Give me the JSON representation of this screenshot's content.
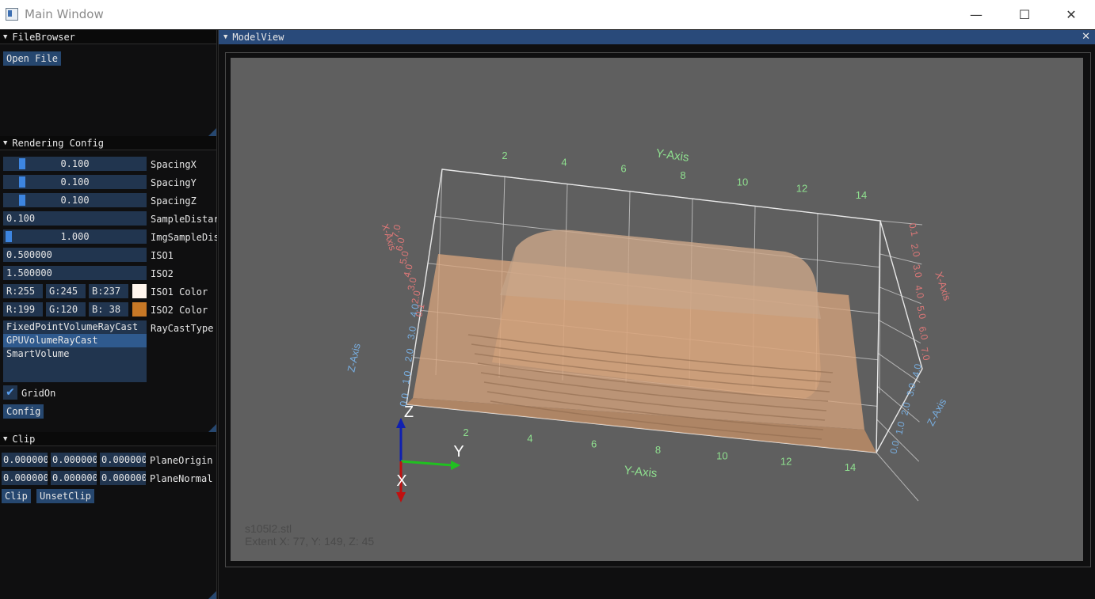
{
  "window": {
    "title": "Main Window",
    "min_glyph": "—",
    "max_glyph": "☐",
    "close_glyph": "✕"
  },
  "file_browser": {
    "header": "FileBrowser",
    "open_file_label": "Open File"
  },
  "rendering": {
    "header": "Rendering Config",
    "spacing_x": {
      "value": "0.100",
      "label": "SpacingX",
      "level": 0.1
    },
    "spacing_y": {
      "value": "0.100",
      "label": "SpacingY",
      "level": 0.1
    },
    "spacing_z": {
      "value": "0.100",
      "label": "SpacingZ",
      "level": 0.1
    },
    "sample_distance": {
      "value": "0.100",
      "label": "SampleDistar"
    },
    "img_sample_distance": {
      "value": "1.000",
      "label": "ImgSampleDis",
      "level": 0.0
    },
    "iso1": {
      "value": "0.500000",
      "label": "ISO1"
    },
    "iso2": {
      "value": "1.500000",
      "label": "ISO2"
    },
    "iso1_color": {
      "r": "R:255",
      "g": "G:245",
      "b": "B:237",
      "label": "ISO1 Color",
      "swatch": "#fff5ed"
    },
    "iso2_color": {
      "r": "R:199",
      "g": "G:120",
      "b": "B: 38",
      "label": "ISO2 Color",
      "swatch": "#c77826"
    },
    "raycast_types": [
      "FixedPointVolumeRayCast",
      "GPUVolumeRayCast",
      "SmartVolume"
    ],
    "raycast_selected": 1,
    "raycast_label": "RayCastType",
    "grid_on": {
      "label": "GridOn",
      "checked": true,
      "check_glyph": "✔"
    },
    "config_label": "Config"
  },
  "clip": {
    "header": "Clip",
    "plane_origin": {
      "values": [
        "0.000000",
        "0.000000",
        "0.000000"
      ],
      "label": "PlaneOrigin"
    },
    "plane_normal": {
      "values": [
        "0.000000",
        "0.000000",
        "0.000000"
      ],
      "label": "PlaneNormal"
    },
    "clip_label": "Clip",
    "unset_clip_label": "UnsetClip"
  },
  "model_view": {
    "header": "ModelView",
    "close_glyph": "✕",
    "file_name": "s105l2.stl",
    "extent": "Extent X: 77, Y: 149, Z: 45",
    "axes": {
      "y_title": "Y-Axis",
      "x_title": "X-Axis",
      "z_title": "Z-Axis",
      "y_ticks": [
        "2",
        "4",
        "6",
        "8",
        "10",
        "12",
        "14"
      ],
      "x_ticks_left": [
        "0.1",
        "2.0",
        "3.0",
        "4.0",
        "5.0",
        "6.0",
        "7.0"
      ],
      "x_ticks_right": [
        "0.1",
        "2.0",
        "3.0",
        "4.0",
        "5.0",
        "6.0",
        "7.0"
      ],
      "z_ticks": [
        "0.0",
        "1.0",
        "2.0",
        "3.0",
        "4.0"
      ],
      "triad": {
        "x": "X",
        "y": "Y",
        "z": "Z"
      }
    },
    "colors": {
      "y_axis": "#8fe08f",
      "x_axis": "#e07878",
      "z_axis": "#78aee0",
      "volume": "#d9a67e",
      "background": "#5f5f5f"
    }
  }
}
